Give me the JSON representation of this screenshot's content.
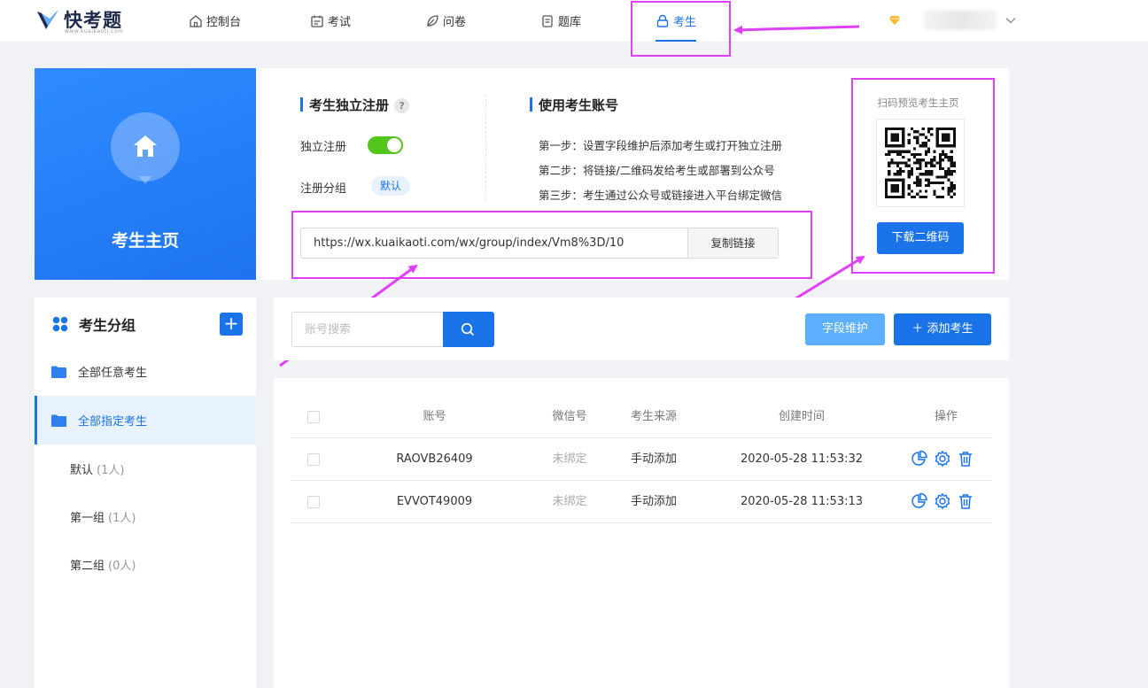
{
  "header": {
    "brand": "快考题",
    "brand_url": "www.kuaikaoti.com",
    "nav": [
      {
        "label": "控制台",
        "icon": "home-icon"
      },
      {
        "label": "考试",
        "icon": "calendar-icon"
      },
      {
        "label": "问卷",
        "icon": "leaf-icon"
      },
      {
        "label": "题库",
        "icon": "database-icon"
      },
      {
        "label": "考生",
        "icon": "lock-icon",
        "active": true
      }
    ]
  },
  "banner": {
    "title": "考生主页",
    "register_section": {
      "title": "考生独立注册",
      "help": "?",
      "toggle_label": "独立注册",
      "toggle_on": true,
      "group_label": "注册分组",
      "group_value": "默认"
    },
    "account_section": {
      "title": "使用考生账号",
      "steps": [
        "第一步：设置字段维护后添加考生或打开独立注册",
        "第二步：将链接/二维码发给考生或部署到公众号",
        "第三步：考生通过公众号或链接进入平台绑定微信"
      ]
    },
    "link": {
      "url": "https://wx.kuaikaoti.com/wx/group/index/Vm8%3D/10",
      "copy_label": "复制链接"
    },
    "qr": {
      "title": "扫码预览考生主页",
      "download_label": "下载二维码"
    }
  },
  "sidebar": {
    "title": "考生分组",
    "add_label": "+",
    "items": [
      {
        "label": "全部任意考生",
        "type": "folder"
      },
      {
        "label": "全部指定考生",
        "type": "folder",
        "active": true
      },
      {
        "label": "默认",
        "count": "(1人)",
        "type": "group"
      },
      {
        "label": "第一组",
        "count": "(1人)",
        "type": "group"
      },
      {
        "label": "第二组",
        "count": "(0人)",
        "type": "group"
      }
    ]
  },
  "toolbar": {
    "search_placeholder": "账号搜索",
    "field_label": "字段维护",
    "add_label": "＋ 添加考生"
  },
  "table": {
    "columns": [
      "账号",
      "微信号",
      "考生来源",
      "创建时间",
      "操作"
    ],
    "rows": [
      {
        "account": "RAOVB26409",
        "wechat": "未绑定",
        "source": "手动添加",
        "created": "2020-05-28 11:53:32"
      },
      {
        "account": "EVVOT49009",
        "wechat": "未绑定",
        "source": "手动添加",
        "created": "2020-05-28 11:53:13"
      }
    ]
  },
  "colors": {
    "primary": "#1a73e8",
    "annotation": "#e040fb",
    "toggle_on": "#52c41a"
  }
}
